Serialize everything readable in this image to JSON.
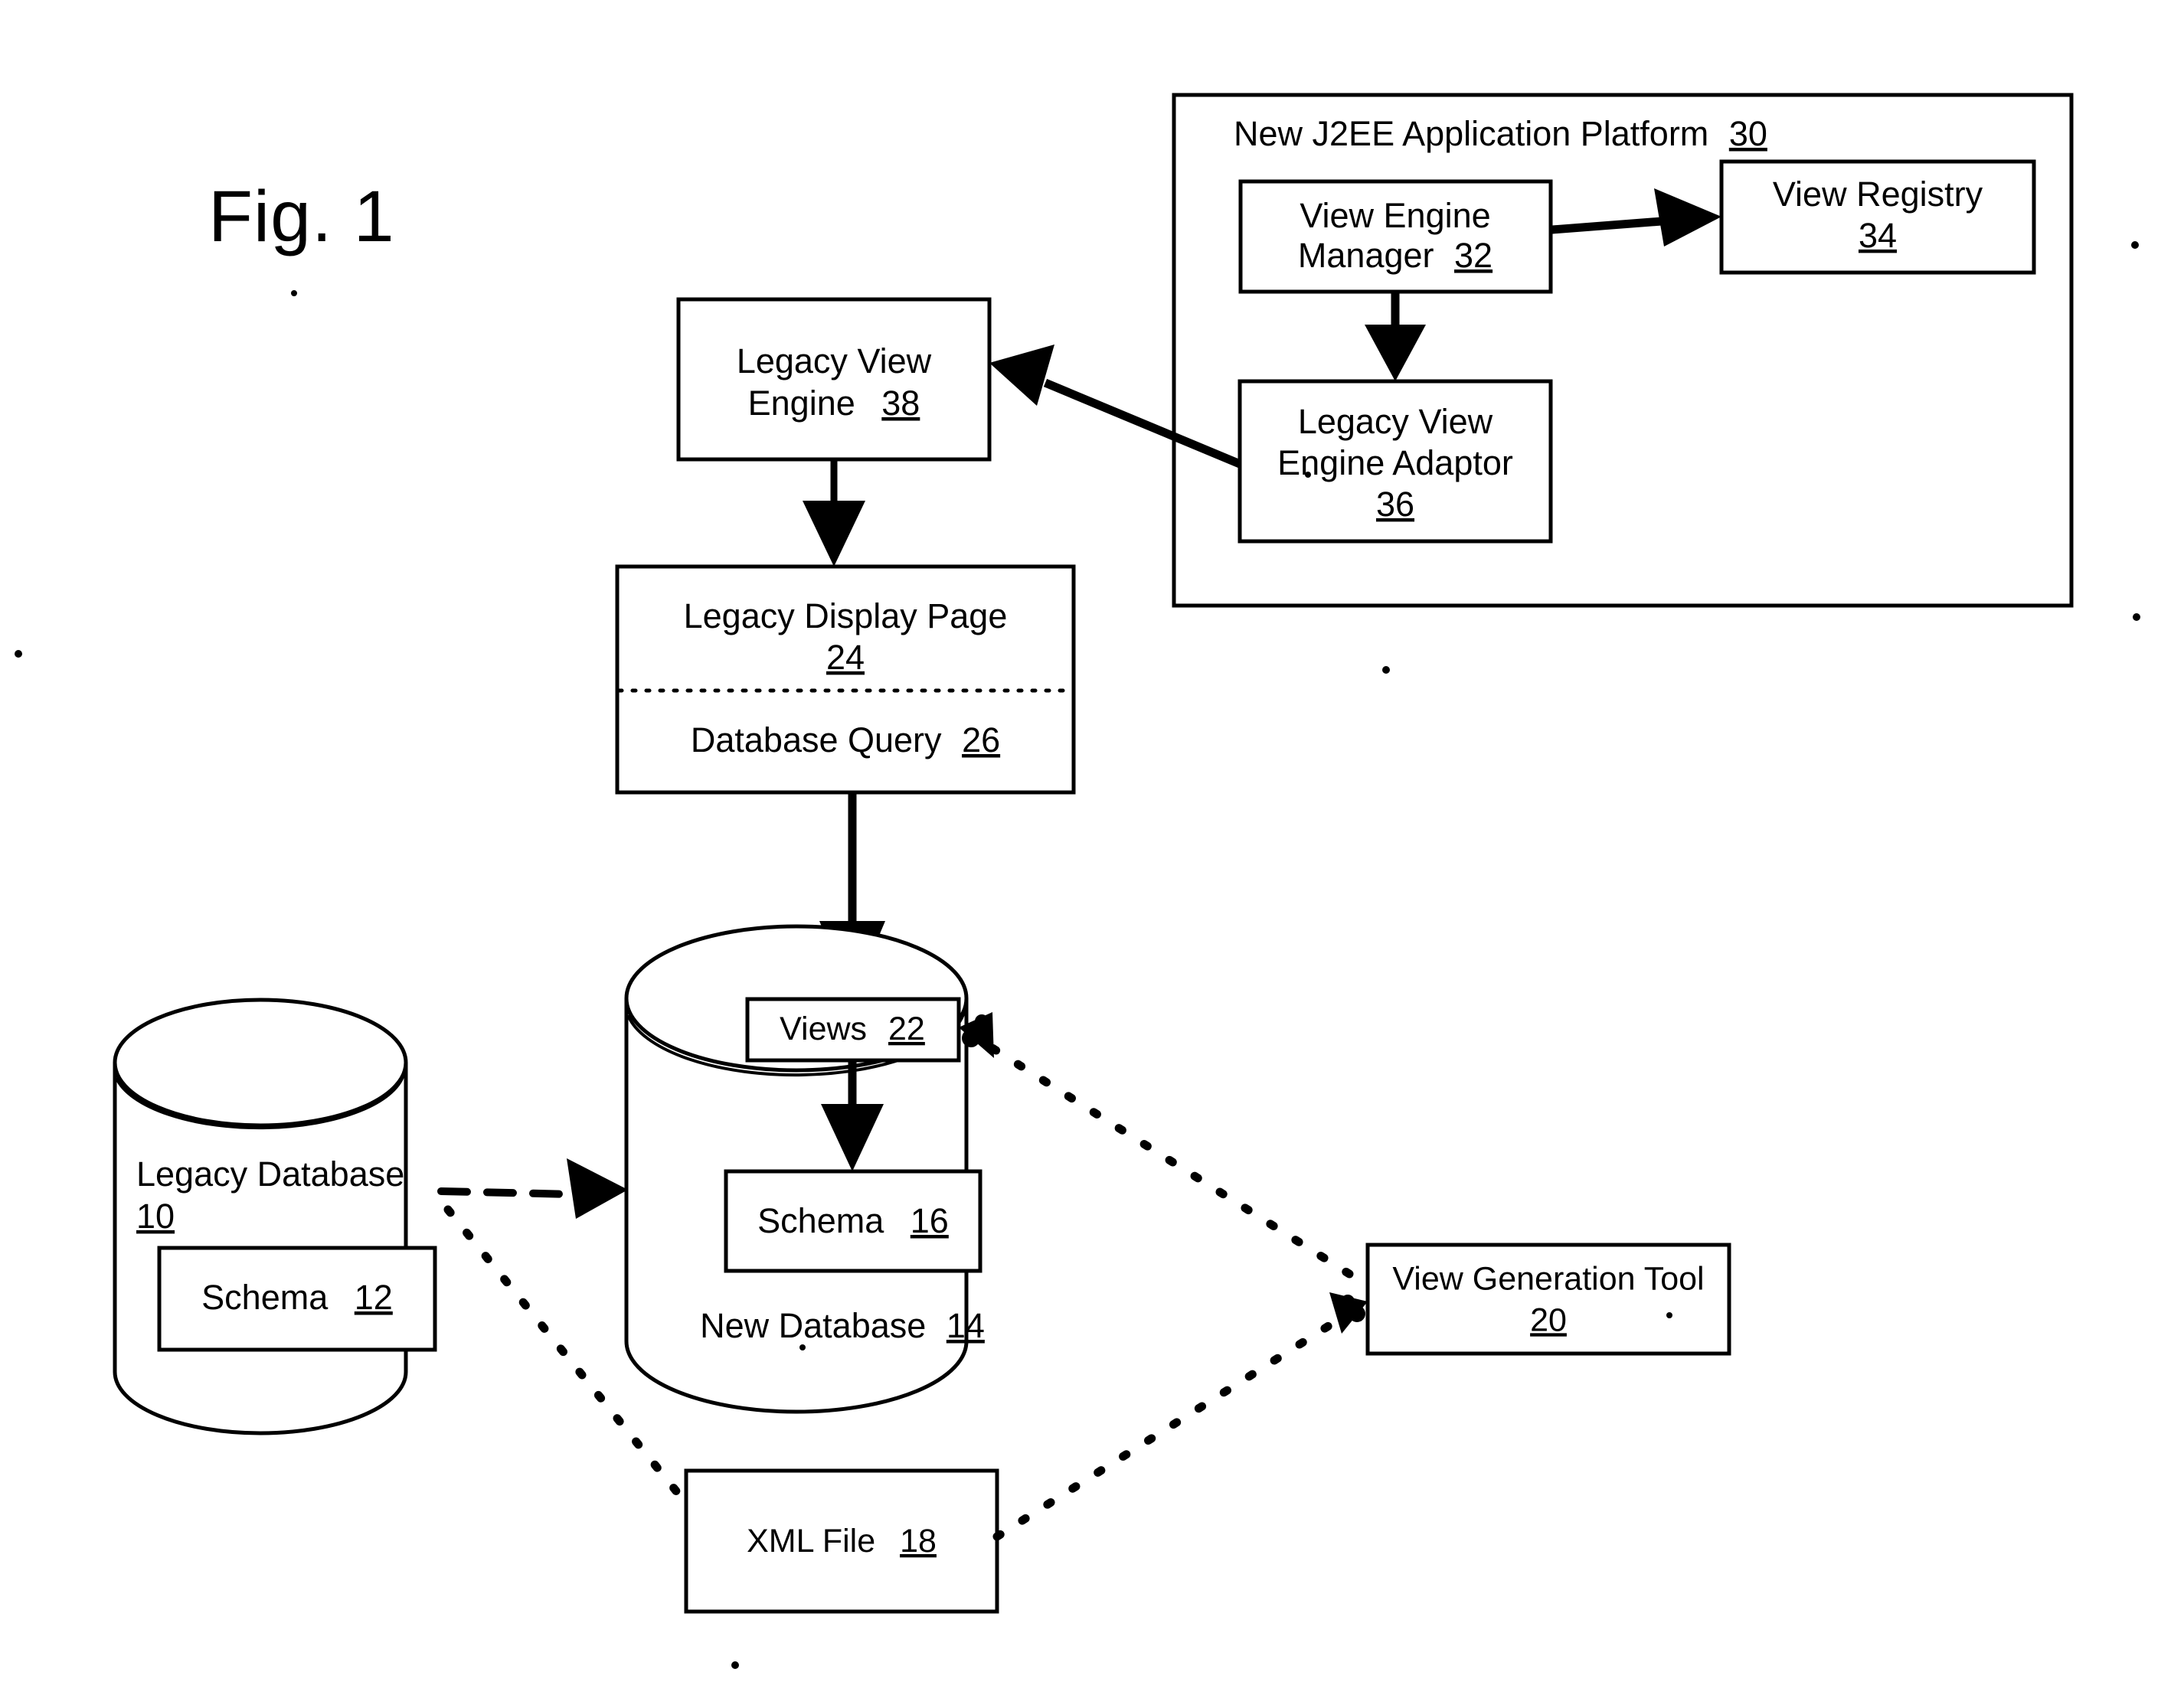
{
  "figure": {
    "title": "Fig. 1"
  },
  "platform": {
    "label": "New J2EE Application Platform",
    "ref": "30"
  },
  "nodes": {
    "view_engine_manager": {
      "line1": "View Engine",
      "line2": "Manager",
      "ref": "32"
    },
    "view_registry": {
      "line1": "View Registry",
      "ref": "34"
    },
    "legacy_view_engine_adaptor": {
      "line1": "Legacy View",
      "line2": "Engine Adaptor",
      "ref": "36"
    },
    "legacy_view_engine": {
      "line1": "Legacy View",
      "line2": "Engine",
      "ref": "38"
    },
    "legacy_display_page": {
      "line1": "Legacy Display Page",
      "ref": "24",
      "line2": "Database Query",
      "ref2": "26"
    },
    "legacy_database": {
      "line1": "Legacy Database",
      "ref": "10"
    },
    "legacy_schema": {
      "line1": "Schema",
      "ref": "12"
    },
    "new_database": {
      "line1": "New Database",
      "ref": "14"
    },
    "new_schema": {
      "line1": "Schema",
      "ref": "16"
    },
    "views": {
      "line1": "Views",
      "ref": "22"
    },
    "xml_file": {
      "line1": "XML File",
      "ref": "18"
    },
    "view_generation_tool": {
      "line1": "View Generation Tool",
      "ref": "20"
    }
  },
  "colors": {
    "ink": "#000000",
    "paper": "#ffffff"
  }
}
